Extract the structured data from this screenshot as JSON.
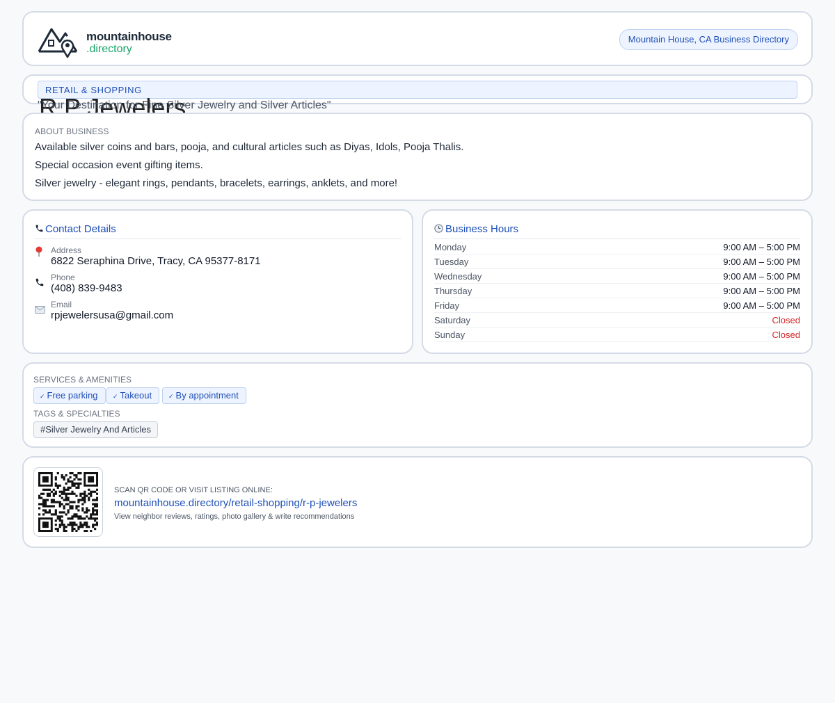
{
  "header": {
    "logo_line1": "mountainhouse",
    "logo_line2": ".directory",
    "directory_pill": "Mountain House, CA Business Directory"
  },
  "listing": {
    "category": "RETAIL & SHOPPING",
    "name": "R P Jewelers",
    "tagline": "\"Your Destination for Fine Silver Jewelry and Silver Articles\""
  },
  "about": {
    "heading": "ABOUT BUSINESS",
    "lines": [
      "Available silver coins and bars, pooja, and cultural articles such as Diyas, Idols, Pooja Thalis.",
      "Special occasion event gifting items.",
      "Silver jewelry - elegant rings, pendants, bracelets, earrings, anklets, and more!"
    ]
  },
  "contact": {
    "title": "Contact Details",
    "title_icon": "phone-icon",
    "address_label": "Address",
    "address": "6822 Seraphina Drive, Tracy, CA 95377-8171",
    "phone_label": "Phone",
    "phone": "(408) 839-9483",
    "email_label": "Email",
    "email": "rpjewelersusa@gmail.com"
  },
  "hours": {
    "title": "Business Hours",
    "title_icon": "clock-icon",
    "rows": [
      {
        "day": "Monday",
        "time": "9:00 AM – 5:00 PM"
      },
      {
        "day": "Tuesday",
        "time": "9:00 AM – 5:00 PM"
      },
      {
        "day": "Wednesday",
        "time": "9:00 AM – 5:00 PM"
      },
      {
        "day": "Thursday",
        "time": "9:00 AM – 5:00 PM"
      },
      {
        "day": "Friday",
        "time": "9:00 AM – 5:00 PM"
      },
      {
        "day": "Saturday",
        "time": "Closed"
      },
      {
        "day": "Sunday",
        "time": "Closed"
      }
    ]
  },
  "services": {
    "heading": "SERVICES & AMENITIES",
    "items": [
      "Free parking",
      "Takeout",
      "By appointment"
    ],
    "tags_heading": "TAGS & SPECIALTIES",
    "tags": [
      "#Silver Jewelry And Articles"
    ]
  },
  "qr": {
    "label": "SCAN QR CODE OR VISIT LISTING ONLINE:",
    "url": "mountainhouse.directory/retail-shopping/r-p-jewelers",
    "subtext": "View neighbor reviews, ratings, photo gallery & write recommendations"
  },
  "colors": {
    "accent": "#1e4fb6",
    "brand_green": "#19a369",
    "closed": "#d32626"
  }
}
